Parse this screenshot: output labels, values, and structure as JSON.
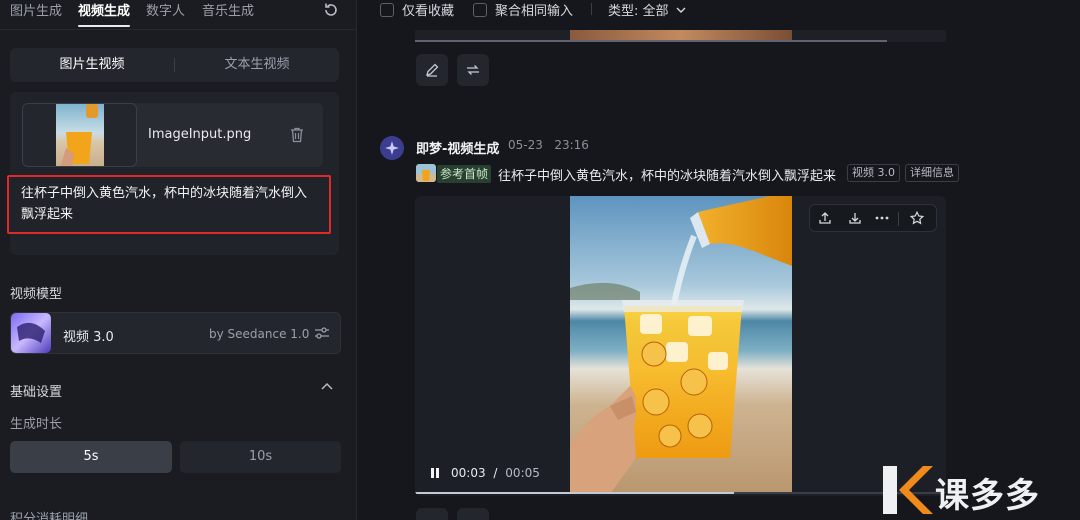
{
  "left_panel": {
    "tabs": [
      "图片生成",
      "视频生成",
      "数字人",
      "音乐生成"
    ],
    "active_tab": "视频生成",
    "mode_segment": [
      "图片生视频",
      "文本生视频"
    ],
    "upload": {
      "filename": "ImageInput.png"
    },
    "prompt_text": "往杯子中倒入黄色汽水，杯中的冰块随着汽水倒入飘浮起来",
    "model_section_label": "视频模型",
    "model": {
      "name": "视频 3.0",
      "provider": "by Seedance 1.0"
    },
    "basic_settings_label": "基础设置",
    "duration_label": "生成时长",
    "durations": [
      "5s",
      "10s"
    ],
    "selected_duration": "5s",
    "points_label": "积分消耗明细"
  },
  "right_panel": {
    "filters": {
      "favorites_label": "仅看收藏",
      "merge_label": "聚合相同输入",
      "type_label": "类型: 全部"
    },
    "generation": {
      "title": "即梦-视频生成",
      "date": "05-23",
      "time": "23:16",
      "ref_tag": "参考首帧",
      "prompt": "往杯子中倒入黄色汽水，杯中的冰块随着汽水倒入飘浮起来",
      "badges": [
        "视频 3.0",
        "详细信息"
      ]
    },
    "player": {
      "current_time": "00:03",
      "separator": "/",
      "duration": "00:05",
      "progress": 0.6
    }
  },
  "watermark_text": "课多多",
  "icons": {
    "refresh": "refresh-icon",
    "trash": "trash-icon",
    "adjust": "sliders-icon",
    "edit": "edit-icon",
    "regenerate": "repeat-icon",
    "upload": "upload-icon",
    "download": "download-icon",
    "more": "more-icon",
    "favorite": "star-icon",
    "pause": "pause-icon"
  },
  "colors": {
    "highlight_border": "#e02a2a",
    "ref_tag_bg": "#27402f",
    "avatar": "#3b3d8f"
  }
}
